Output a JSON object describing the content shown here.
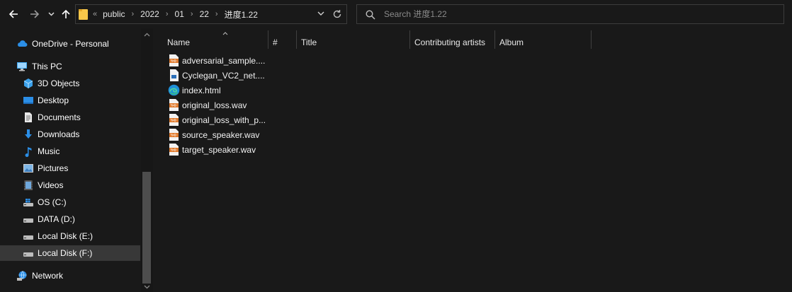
{
  "toolbar": {
    "back_icon": "arrow-left-icon",
    "forward_icon": "arrow-right-icon",
    "recent_icon": "chevron-down-icon",
    "up_icon": "arrow-up-icon",
    "address": {
      "overflow": "«",
      "crumbs": [
        "public",
        "2022",
        "01",
        "22",
        "进度1.22"
      ]
    },
    "search_placeholder": "Search 进度1.22"
  },
  "sidebar": {
    "items": [
      {
        "label": "OneDrive - Personal",
        "icon": "cloud-icon"
      },
      {
        "label": "This PC",
        "icon": "computer-icon"
      },
      {
        "label": "3D Objects",
        "icon": "cube-icon"
      },
      {
        "label": "Desktop",
        "icon": "desktop-icon"
      },
      {
        "label": "Documents",
        "icon": "document-icon"
      },
      {
        "label": "Downloads",
        "icon": "download-icon"
      },
      {
        "label": "Music",
        "icon": "music-note-icon"
      },
      {
        "label": "Pictures",
        "icon": "picture-icon"
      },
      {
        "label": "Videos",
        "icon": "video-icon"
      },
      {
        "label": "OS (C:)",
        "icon": "drive-windows-icon"
      },
      {
        "label": "DATA (D:)",
        "icon": "drive-icon"
      },
      {
        "label": "Local Disk (E:)",
        "icon": "drive-icon"
      },
      {
        "label": "Local Disk (F:)",
        "icon": "drive-icon"
      },
      {
        "label": "Network",
        "icon": "network-icon"
      }
    ],
    "selected": "Local Disk (F:)"
  },
  "columns": [
    "Name",
    "#",
    "Title",
    "Contributing artists",
    "Album"
  ],
  "files": [
    {
      "name": "adversarial_sample....",
      "icon": "wav-file-icon"
    },
    {
      "name": "Cyclegan_VC2_net....",
      "icon": "generic-file-icon"
    },
    {
      "name": "index.html",
      "icon": "edge-html-icon"
    },
    {
      "name": "original_loss.wav",
      "icon": "wav-file-icon"
    },
    {
      "name": "original_loss_with_p...",
      "icon": "wav-file-icon"
    },
    {
      "name": "source_speaker.wav",
      "icon": "wav-file-icon"
    },
    {
      "name": "target_speaker.wav",
      "icon": "wav-file-icon"
    }
  ],
  "colors": {
    "background": "#191919",
    "selection": "#383838",
    "folder_yellow": "#f8c74a",
    "wav_orange": "#e07b2e",
    "accent_blue": "#2b8ee6"
  }
}
